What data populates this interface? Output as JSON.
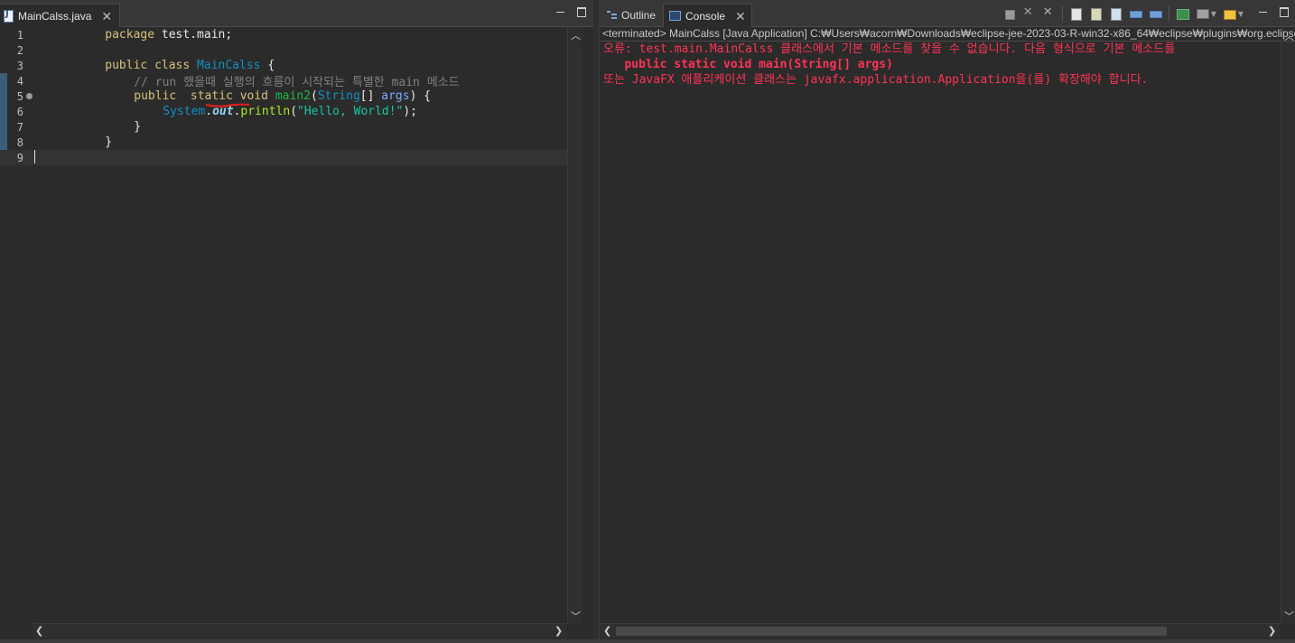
{
  "editor": {
    "tab_label": "MainCalss.java",
    "lines": {
      "n1": "1",
      "n2": "2",
      "n3": "3",
      "n4": "4",
      "n5": "5",
      "n6": "6",
      "n7": "7",
      "n8": "8",
      "n9": "9",
      "l1_kw": "package",
      "l1_rest": " test.main;",
      "l3_kw1": "public",
      "l3_kw2": " class ",
      "l3_cls": "MainCalss",
      "l3_rest": " {",
      "l4_comment": "// run 했을때 실행의 흐름이 시작되는 특별한 main 메소드",
      "l5_kw1": "public",
      "l5_kw2": "  static",
      "l5_kw3": " void ",
      "l5_method": "main2",
      "l5_paren": "(",
      "l5_type": "String",
      "l5_arr": "[] ",
      "l5_param": "args",
      "l5_rest": ") {",
      "l6_cls": "System",
      "l6_dot1": ".",
      "l6_field": "out",
      "l6_dot2": ".",
      "l6_call": "println",
      "l6_open": "(",
      "l6_str": "\"Hello, World!\"",
      "l6_close": ");",
      "l7": "}",
      "l8": "}"
    }
  },
  "console_panel": {
    "tab_outline": "Outline",
    "tab_console": "Console",
    "status": "<terminated> MainCalss [Java Application] C:₩Users₩acorn₩Downloads₩eclipse-jee-2023-03-R-win32-x86_64₩eclipse₩plugins₩org.eclipse.ju",
    "output": [
      "오류: test.main.MainCalss 클래스에서 기본 메소드를 찾을 수 없습니다. 다음 형식으로 기본 메소드를",
      "   public static void main(String[] args)",
      "또는 JavaFX 애플리케이션 클래스는 javafx.application.Application을(를) 확장해야 합니다."
    ]
  },
  "colors": {
    "error_text": "#ff3355",
    "editor_bg": "#2b2b2b",
    "squiggle": "#e0201c"
  },
  "icons": [
    "java-file-icon",
    "close-icon",
    "minimize-icon",
    "maximize-icon",
    "outline-icon",
    "console-icon",
    "terminate-icon",
    "remove-launch-icon",
    "remove-all-icon",
    "scroll-lock-icon",
    "word-wrap-icon",
    "show-on-output-icon",
    "pin-console-icon",
    "display-console-icon",
    "new-console-icon",
    "chevron-up-icon",
    "chevron-down-icon",
    "chevron-left-icon",
    "chevron-right-icon"
  ]
}
